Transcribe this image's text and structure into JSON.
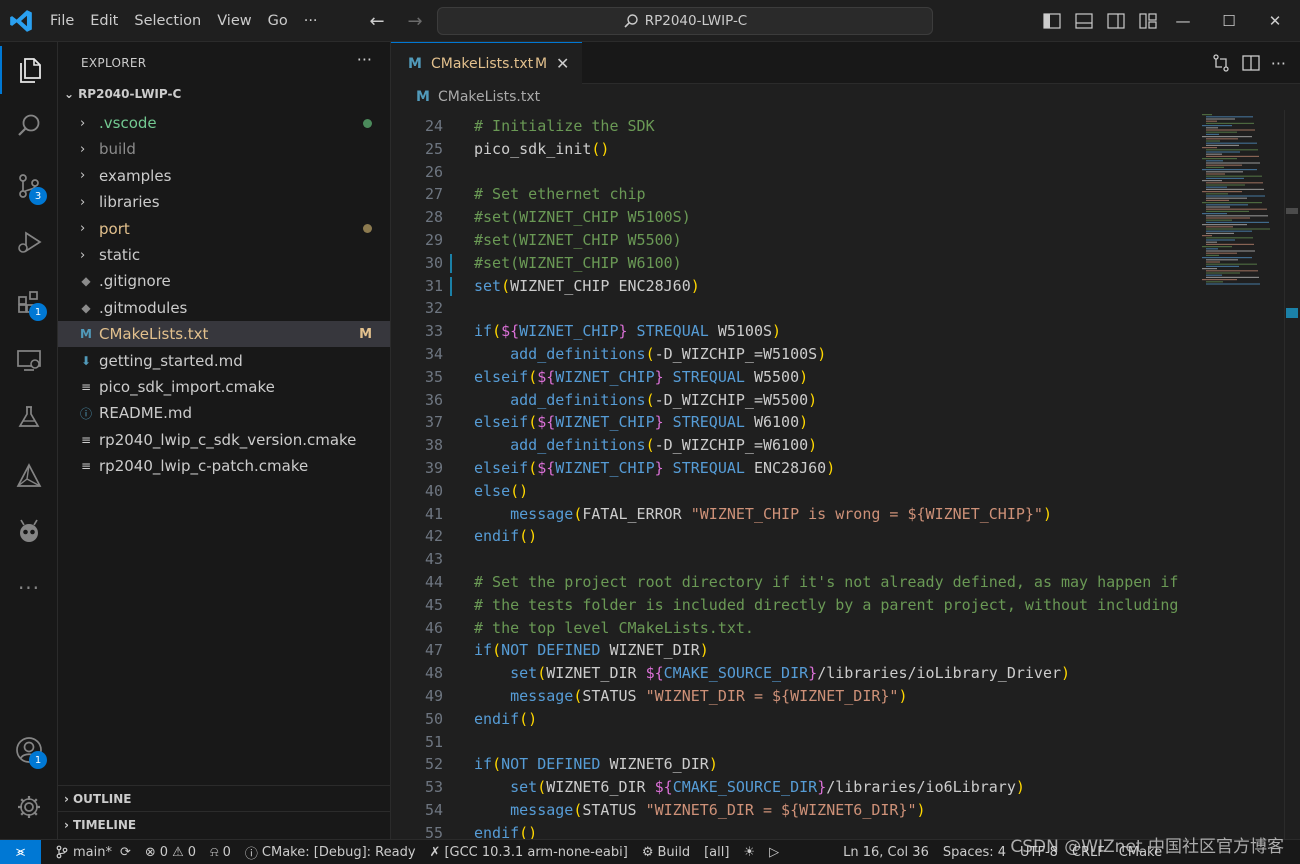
{
  "titlebar": {
    "menu": [
      "File",
      "Edit",
      "Selection",
      "View",
      "Go",
      "···"
    ],
    "search_text": "RP2040-LWIP-C",
    "window": {
      "minimize": "—",
      "maximize": "☐",
      "close": "✕"
    }
  },
  "activity": {
    "source_control_badge": "3",
    "extensions_badge": "1",
    "accounts_badge": "1"
  },
  "sidebar": {
    "header": "EXPLORER",
    "more": "···",
    "root": "RP2040-LWIP-C",
    "items": [
      {
        "label": "vscode",
        "kind": "folder",
        "dot": "#4b8a5b",
        "color": "#73c991"
      },
      {
        "label": "build",
        "kind": "folder",
        "color": "#8b8b8b"
      },
      {
        "label": "examples",
        "kind": "folder",
        "color": "#cccccc"
      },
      {
        "label": "libraries",
        "kind": "folder",
        "color": "#cccccc"
      },
      {
        "label": "port",
        "kind": "folder",
        "dot": "#8c7a4f",
        "color": "#e2c08d"
      },
      {
        "label": "static",
        "kind": "folder",
        "color": "#cccccc"
      },
      {
        "label": ".gitignore",
        "kind": "git",
        "color": "#cccccc"
      },
      {
        "label": ".gitmodules",
        "kind": "git",
        "color": "#cccccc"
      },
      {
        "label": "CMakeLists.txt",
        "kind": "cmake",
        "badge": "M",
        "color": "#e2c08d"
      },
      {
        "label": "getting_started.md",
        "kind": "md",
        "color": "#cccccc"
      },
      {
        "label": "pico_sdk_import.cmake",
        "kind": "lines",
        "color": "#cccccc"
      },
      {
        "label": "README.md",
        "kind": "info",
        "color": "#cccccc"
      },
      {
        "label": "rp2040_lwip_c_sdk_version.cmake",
        "kind": "lines",
        "color": "#cccccc"
      },
      {
        "label": "rp2040_lwip_c-patch.cmake",
        "kind": "lines",
        "color": "#cccccc"
      }
    ],
    "outline": "OUTLINE",
    "timeline": "TIMELINE"
  },
  "editor": {
    "tab": {
      "icon": "M",
      "label": "CMakeLists.txt",
      "modified": "M",
      "close": "✕"
    },
    "breadcrumb": "CMakeLists.txt",
    "lines": [
      {
        "n": "24",
        "t": [
          [
            "# Initialize the SDK",
            "#6a9955"
          ]
        ]
      },
      {
        "n": "25",
        "t": [
          [
            "pico_sdk_init",
            "#cccccc"
          ],
          [
            "()",
            "#ffd700"
          ]
        ]
      },
      {
        "n": "26",
        "t": []
      },
      {
        "n": "27",
        "t": [
          [
            "# Set ethernet chip",
            "#6a9955"
          ]
        ]
      },
      {
        "n": "28",
        "t": [
          [
            "#set(WIZNET_CHIP W5100S)",
            "#6a9955"
          ]
        ]
      },
      {
        "n": "29",
        "t": [
          [
            "#set(WIZNET_CHIP W5500)",
            "#6a9955"
          ]
        ]
      },
      {
        "n": "30",
        "t": [
          [
            "#set(WIZNET_CHIP W6100)",
            "#6a9955"
          ]
        ],
        "mod": true
      },
      {
        "n": "31",
        "t": [
          [
            "set",
            "#569cd6"
          ],
          [
            "(",
            "#ffd700"
          ],
          [
            "WIZNET_CHIP ENC28J60",
            "#cccccc"
          ],
          [
            ")",
            "#ffd700"
          ]
        ],
        "mod": true
      },
      {
        "n": "32",
        "t": []
      },
      {
        "n": "33",
        "t": [
          [
            "if",
            "#569cd6"
          ],
          [
            "(",
            "#ffd700"
          ],
          [
            "${",
            "#da70d6"
          ],
          [
            "WIZNET_CHIP",
            "#569cd6"
          ],
          [
            "}",
            "#da70d6"
          ],
          [
            " STREQUAL",
            "#569cd6"
          ],
          [
            " W5100S",
            "#cccccc"
          ],
          [
            ")",
            "#ffd700"
          ]
        ]
      },
      {
        "n": "34",
        "t": [
          [
            "    add_definitions",
            "#569cd6"
          ],
          [
            "(",
            "#ffd700"
          ],
          [
            "-D_WIZCHIP_=W5100S",
            "#cccccc"
          ],
          [
            ")",
            "#ffd700"
          ]
        ]
      },
      {
        "n": "35",
        "t": [
          [
            "elseif",
            "#569cd6"
          ],
          [
            "(",
            "#ffd700"
          ],
          [
            "${",
            "#da70d6"
          ],
          [
            "WIZNET_CHIP",
            "#569cd6"
          ],
          [
            "}",
            "#da70d6"
          ],
          [
            " STREQUAL",
            "#569cd6"
          ],
          [
            " W5500",
            "#cccccc"
          ],
          [
            ")",
            "#ffd700"
          ]
        ]
      },
      {
        "n": "36",
        "t": [
          [
            "    add_definitions",
            "#569cd6"
          ],
          [
            "(",
            "#ffd700"
          ],
          [
            "-D_WIZCHIP_=W5500",
            "#cccccc"
          ],
          [
            ")",
            "#ffd700"
          ]
        ]
      },
      {
        "n": "37",
        "t": [
          [
            "elseif",
            "#569cd6"
          ],
          [
            "(",
            "#ffd700"
          ],
          [
            "${",
            "#da70d6"
          ],
          [
            "WIZNET_CHIP",
            "#569cd6"
          ],
          [
            "}",
            "#da70d6"
          ],
          [
            " STREQUAL",
            "#569cd6"
          ],
          [
            " W6100",
            "#cccccc"
          ],
          [
            ")",
            "#ffd700"
          ]
        ]
      },
      {
        "n": "38",
        "t": [
          [
            "    add_definitions",
            "#569cd6"
          ],
          [
            "(",
            "#ffd700"
          ],
          [
            "-D_WIZCHIP_=W6100",
            "#cccccc"
          ],
          [
            ")",
            "#ffd700"
          ]
        ]
      },
      {
        "n": "39",
        "t": [
          [
            "elseif",
            "#569cd6"
          ],
          [
            "(",
            "#ffd700"
          ],
          [
            "${",
            "#da70d6"
          ],
          [
            "WIZNET_CHIP",
            "#569cd6"
          ],
          [
            "}",
            "#da70d6"
          ],
          [
            " STREQUAL",
            "#569cd6"
          ],
          [
            " ENC28J60",
            "#cccccc"
          ],
          [
            ")",
            "#ffd700"
          ]
        ]
      },
      {
        "n": "40",
        "t": [
          [
            "else",
            "#569cd6"
          ],
          [
            "()",
            "#ffd700"
          ]
        ]
      },
      {
        "n": "41",
        "t": [
          [
            "    message",
            "#569cd6"
          ],
          [
            "(",
            "#ffd700"
          ],
          [
            "FATAL_ERROR ",
            "#cccccc"
          ],
          [
            "\"WIZNET_CHIP is wrong = ${WIZNET_CHIP}\"",
            "#ce9178"
          ],
          [
            ")",
            "#ffd700"
          ]
        ]
      },
      {
        "n": "42",
        "t": [
          [
            "endif",
            "#569cd6"
          ],
          [
            "()",
            "#ffd700"
          ]
        ]
      },
      {
        "n": "43",
        "t": []
      },
      {
        "n": "44",
        "t": [
          [
            "# Set the project root directory if it's not already defined, as may happen if",
            "#6a9955"
          ]
        ]
      },
      {
        "n": "45",
        "t": [
          [
            "# the tests folder is included directly by a parent project, without including",
            "#6a9955"
          ]
        ]
      },
      {
        "n": "46",
        "t": [
          [
            "# the top level CMakeLists.txt.",
            "#6a9955"
          ]
        ]
      },
      {
        "n": "47",
        "t": [
          [
            "if",
            "#569cd6"
          ],
          [
            "(",
            "#ffd700"
          ],
          [
            "NOT DEFINED",
            "#569cd6"
          ],
          [
            " WIZNET_DIR",
            "#cccccc"
          ],
          [
            ")",
            "#ffd700"
          ]
        ]
      },
      {
        "n": "48",
        "t": [
          [
            "    set",
            "#569cd6"
          ],
          [
            "(",
            "#ffd700"
          ],
          [
            "WIZNET_DIR ",
            "#cccccc"
          ],
          [
            "${",
            "#da70d6"
          ],
          [
            "CMAKE_SOURCE_DIR",
            "#569cd6"
          ],
          [
            "}",
            "#da70d6"
          ],
          [
            "/libraries/ioLibrary_Driver",
            "#cccccc"
          ],
          [
            ")",
            "#ffd700"
          ]
        ]
      },
      {
        "n": "49",
        "t": [
          [
            "    message",
            "#569cd6"
          ],
          [
            "(",
            "#ffd700"
          ],
          [
            "STATUS ",
            "#cccccc"
          ],
          [
            "\"WIZNET_DIR = ${WIZNET_DIR}\"",
            "#ce9178"
          ],
          [
            ")",
            "#ffd700"
          ]
        ]
      },
      {
        "n": "50",
        "t": [
          [
            "endif",
            "#569cd6"
          ],
          [
            "()",
            "#ffd700"
          ]
        ]
      },
      {
        "n": "51",
        "t": []
      },
      {
        "n": "52",
        "t": [
          [
            "if",
            "#569cd6"
          ],
          [
            "(",
            "#ffd700"
          ],
          [
            "NOT DEFINED",
            "#569cd6"
          ],
          [
            " WIZNET6_DIR",
            "#cccccc"
          ],
          [
            ")",
            "#ffd700"
          ]
        ]
      },
      {
        "n": "53",
        "t": [
          [
            "    set",
            "#569cd6"
          ],
          [
            "(",
            "#ffd700"
          ],
          [
            "WIZNET6_DIR ",
            "#cccccc"
          ],
          [
            "${",
            "#da70d6"
          ],
          [
            "CMAKE_SOURCE_DIR",
            "#569cd6"
          ],
          [
            "}",
            "#da70d6"
          ],
          [
            "/libraries/io6Library",
            "#cccccc"
          ],
          [
            ")",
            "#ffd700"
          ]
        ]
      },
      {
        "n": "54",
        "t": [
          [
            "    message",
            "#569cd6"
          ],
          [
            "(",
            "#ffd700"
          ],
          [
            "STATUS ",
            "#cccccc"
          ],
          [
            "\"WIZNET6_DIR = ${WIZNET6_DIR}\"",
            "#ce9178"
          ],
          [
            ")",
            "#ffd700"
          ]
        ]
      },
      {
        "n": "55",
        "t": [
          [
            "endif",
            "#569cd6"
          ],
          [
            "()",
            "#ffd700"
          ]
        ]
      }
    ]
  },
  "statusbar": {
    "branch": "main*",
    "errors": "0",
    "warnings": "0",
    "ports": "0",
    "cmake": "CMake: [Debug]: Ready",
    "kit": "[GCC 10.3.1 arm-none-eabi]",
    "build": "Build",
    "target": "[all]",
    "position": "Ln 16, Col 36",
    "spaces": "Spaces: 4",
    "encoding": "UTF-8",
    "eol": "CRLF",
    "language": "CMake"
  },
  "watermark": "CSDN @WIZnet 中国社区官方博客"
}
